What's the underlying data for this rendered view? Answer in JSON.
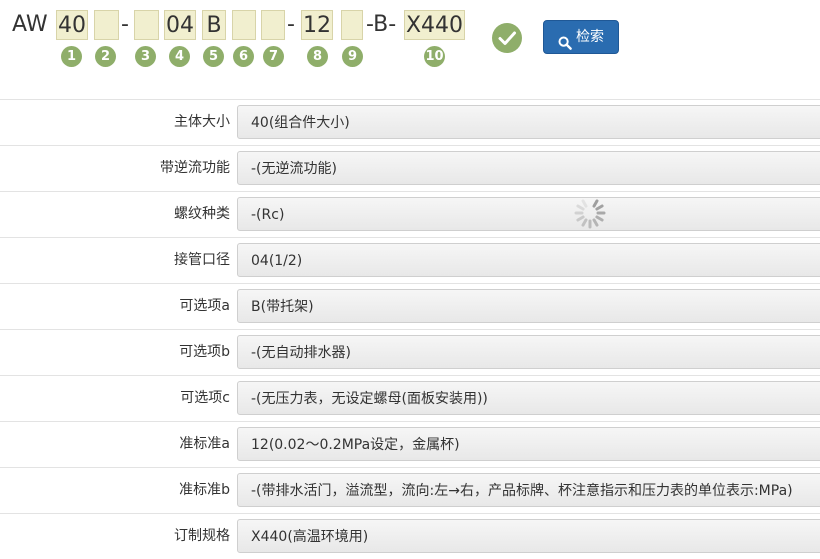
{
  "model_code": {
    "prefix": "AW",
    "seg1": "40",
    "seg2": "",
    "dash1": "-",
    "seg3": "",
    "seg4": "04",
    "seg5": "B",
    "seg6": "",
    "seg7": "",
    "dash2": "-",
    "seg8": "12",
    "seg9": "",
    "dash3": "-B-",
    "seg10": "X440",
    "numbers": [
      "1",
      "2",
      "3",
      "4",
      "5",
      "6",
      "7",
      "8",
      "9",
      "10"
    ]
  },
  "search_button": {
    "label": "检索"
  },
  "spec_rows": [
    {
      "label": "主体大小",
      "value": "40(组合件大小)"
    },
    {
      "label": "带逆流功能",
      "value": "-(无逆流功能)"
    },
    {
      "label": "螺纹种类",
      "value": "-(Rc)"
    },
    {
      "label": "接管口径",
      "value": "04(1/2)"
    },
    {
      "label": "可选项a",
      "value": "B(带托架)"
    },
    {
      "label": "可选项b",
      "value": "-(无自动排水器)"
    },
    {
      "label": "可选项c",
      "value": "-(无压力表，无设定螺母(面板安装用))"
    },
    {
      "label": "准标准a",
      "value": "12(0.02～0.2MPa设定，金属杯)"
    },
    {
      "label": "准标准b",
      "value": "-(带排水活门，溢流型，流向:左→右，产品标牌、杯注意指示和压力表的单位表示:MPa)"
    },
    {
      "label": "订制规格",
      "value": "X440(高温环境用)"
    }
  ],
  "colors": {
    "accent_green": "#8fae6a",
    "button_blue": "#2a6cb0",
    "code_box_bg": "#f1efcf"
  }
}
